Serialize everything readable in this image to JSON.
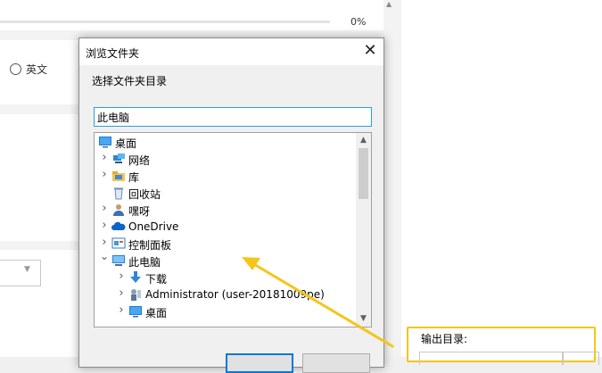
{
  "background": {
    "progress_percent_text": "0%",
    "progress_value": 0,
    "radio_label": "英文",
    "output_label": "输出目录:"
  },
  "dialog": {
    "title": "浏览文件夹",
    "close_glyph": "✕",
    "description": "选择文件夹目录",
    "folder_value": "此电脑",
    "tree": [
      {
        "label": "桌面",
        "icon": "desktop-icon",
        "expander": "",
        "level": 0
      },
      {
        "label": "网络",
        "icon": "network-icon",
        "expander": "collapsed",
        "level": 1
      },
      {
        "label": "库",
        "icon": "library-icon",
        "expander": "collapsed",
        "level": 1
      },
      {
        "label": "回收站",
        "icon": "recycle-bin-icon",
        "expander": "",
        "level": 1
      },
      {
        "label": "嘿呀",
        "icon": "user-icon",
        "expander": "collapsed",
        "level": 1
      },
      {
        "label": "OneDrive",
        "icon": "cloud-icon",
        "expander": "collapsed",
        "level": 1
      },
      {
        "label": "控制面板",
        "icon": "control-panel-icon",
        "expander": "collapsed",
        "level": 1
      },
      {
        "label": "此电脑",
        "icon": "computer-icon",
        "expander": "expanded",
        "level": 1
      },
      {
        "label": "下载",
        "icon": "download-icon",
        "expander": "collapsed",
        "level": 2
      },
      {
        "label": "Administrator (user-20181009pe)",
        "icon": "user-folder-icon",
        "expander": "collapsed",
        "level": 2
      },
      {
        "label": "桌面",
        "icon": "desktop-icon",
        "expander": "collapsed",
        "level": 2
      }
    ]
  },
  "colors": {
    "highlight": "#f5c518",
    "focus_border": "#2aa0d4",
    "primary_button_border": "#0078d7"
  }
}
